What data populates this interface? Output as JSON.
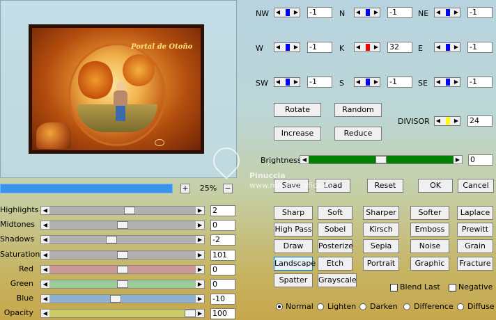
{
  "preview": {
    "title_text": "Portal de Otoño"
  },
  "zoom": {
    "plus": "+",
    "value": "25%",
    "minus": "−"
  },
  "sliders": [
    {
      "label": "Highlights",
      "value": "2",
      "level": 0.55,
      "color": "#b0b0b0"
    },
    {
      "label": "Midtones",
      "value": "0",
      "level": 0.5,
      "color": "#b0b0b0"
    },
    {
      "label": "Shadows",
      "value": "-2",
      "level": 0.42,
      "color": "#b0b0b0"
    },
    {
      "label": "Saturation",
      "value": "101",
      "level": 0.5,
      "color": "#b0b0b0"
    },
    {
      "label": "Red",
      "value": "0",
      "level": 0.5,
      "color": "#cc9999"
    },
    {
      "label": "Green",
      "value": "0",
      "level": 0.5,
      "color": "#99cc99"
    },
    {
      "label": "Blue",
      "value": "-10",
      "level": 0.45,
      "color": "#8fb0cf"
    },
    {
      "label": "Opacity",
      "value": "100",
      "level": 1.0,
      "color": "#cccc66"
    }
  ],
  "kernel": [
    {
      "label": "NW",
      "value": "-1",
      "color": "#0000ff"
    },
    {
      "label": "N",
      "value": "-1",
      "color": "#0000ff"
    },
    {
      "label": "NE",
      "value": "-1",
      "color": "#0000ff"
    },
    {
      "label": "W",
      "value": "-1",
      "color": "#0000ff"
    },
    {
      "label": "K",
      "value": "32",
      "color": "#ff0000"
    },
    {
      "label": "E",
      "value": "-1",
      "color": "#0000ff"
    },
    {
      "label": "SW",
      "value": "-1",
      "color": "#0000ff"
    },
    {
      "label": "S",
      "value": "-1",
      "color": "#0000ff"
    },
    {
      "label": "SE",
      "value": "-1",
      "color": "#0000ff"
    }
  ],
  "buttons": {
    "rotate": "Rotate",
    "random": "Random",
    "increase": "Increase",
    "reduce": "Reduce",
    "save": "Save",
    "load": "Load",
    "reset": "Reset",
    "ok": "OK",
    "cancel": "Cancel"
  },
  "divisor": {
    "label": "DIVISOR",
    "value": "24",
    "color": "#ffff00"
  },
  "brightness": {
    "label": "Brightness",
    "value": "0",
    "level": 0.5,
    "color": "#008000"
  },
  "presets": [
    [
      "Sharp",
      "Soft",
      "Sharper",
      "Softer",
      "Laplace"
    ],
    [
      "High Pass",
      "Sobel",
      "Kirsch",
      "Emboss",
      "Prewitt"
    ],
    [
      "Draw",
      "Posterize",
      "Sepia",
      "Noise",
      "Grain"
    ],
    [
      "Landscape",
      "Etch",
      "Portrait",
      "Graphic",
      "Fracture"
    ],
    [
      "Spatter",
      "Grayscale"
    ]
  ],
  "options": {
    "blend_last": "Blend Last",
    "negative": "Negative"
  },
  "modes": {
    "normal": "Normal",
    "lighten": "Lighten",
    "darken": "Darken",
    "difference": "Difference",
    "diffuse": "Diffuse"
  },
  "watermark": {
    "line1": "Pinuccia",
    "line2": "www.misalegrafica.eu"
  }
}
